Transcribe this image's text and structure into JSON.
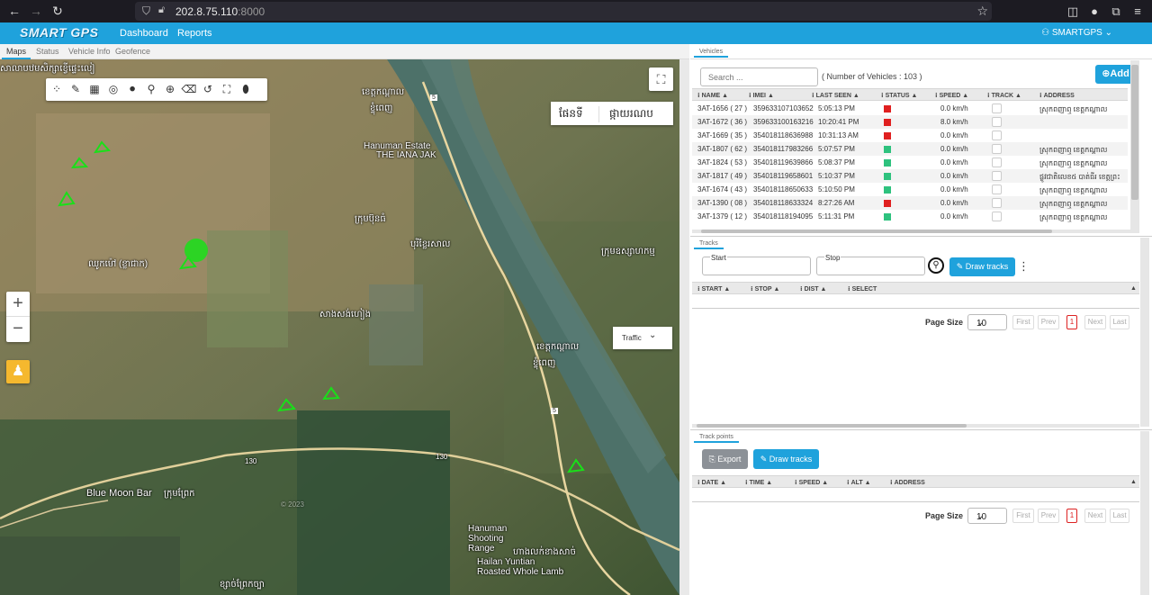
{
  "browser": {
    "url_host": "202.8.75.110",
    "url_port": ":8000"
  },
  "app": {
    "logo": "SMART GPS",
    "menu": [
      "Dashboard",
      "Reports"
    ],
    "user": "SMARTGPS"
  },
  "left_tabs": [
    "Maps",
    "Status",
    "Vehicle Info",
    "Geofence"
  ],
  "map": {
    "type_labels": [
      "ផែនទី",
      "ផ្កាយរណប"
    ],
    "traffic_label": "Traffic",
    "zoom_in": "+",
    "zoom_out": "−",
    "labels": [
      "សាលាបឋមសិក្សាខ្វើផ្ទេះលៀ",
      "ខេត្តកណ្ដាល",
      "ខ្ទុំពេញ",
      "Hanuman Estate",
      "THE IANA JAK",
      "ក្រុមប៊ុនធំ",
      "បុរីខ្លែរសាល",
      "ឈូកម៉ៅ (ខ្លាជាក)",
      "ក្រុមឧស្សាហកម្ម",
      "សាងសង់ហៀង",
      "ខេត្តកណ្ដាល",
      "ខ្ទុំពេញ",
      "Blue Moon Bar",
      "ក្រុមព្រែក",
      "Hanuman Shooting Range",
      "Hailan Yuntian Roasted Whole Lamb",
      "ហាងលក់ខាងសាច់",
      "ខ្សាច់ព្រែកច្បា"
    ],
    "road_labels": [
      "5",
      "130",
      "130",
      "5"
    ],
    "watermark": "© 2023"
  },
  "vehicles": {
    "tab": "Vehicles",
    "search_placeholder": "Search ...",
    "count_text": "( Number of Vehicles : 103 )",
    "add_label": "Add",
    "columns": [
      "NAME",
      "IMEI",
      "LAST SEEN",
      "STATUS",
      "SPEED",
      "TRACK",
      "ADDRESS"
    ],
    "rows": [
      {
        "name": "3AT-1656 ( 27 )",
        "imei": "359633107103652",
        "last_seen": "5:05:13 PM",
        "status": "red",
        "speed": "0.0 km/h",
        "address": "ស្រុកពញាឮ ខេត្តកណ្ដាល"
      },
      {
        "name": "3AT-1672 ( 36 )",
        "imei": "359633100163216",
        "last_seen": "10:20:41 PM",
        "status": "red",
        "speed": "8.0 km/h",
        "address": ""
      },
      {
        "name": "3AT-1669 ( 35 )",
        "imei": "354018118636988",
        "last_seen": "10:31:13 AM",
        "status": "red",
        "speed": "0.0 km/h",
        "address": ""
      },
      {
        "name": "3AT-1807 ( 62 )",
        "imei": "354018117983266",
        "last_seen": "5:07:57 PM",
        "status": "green",
        "speed": "0.0 km/h",
        "address": "ស្រុកពញាឮ ខេត្តកណ្ដាល"
      },
      {
        "name": "3AT-1824 ( 53 )",
        "imei": "354018119639866",
        "last_seen": "5:08:37 PM",
        "status": "green",
        "speed": "0.0 km/h",
        "address": "ស្រុកពញាឮ ខេត្តកណ្ដាល"
      },
      {
        "name": "3AT-1817 ( 49 )",
        "imei": "354018119658601",
        "last_seen": "5:10:37 PM",
        "status": "green",
        "speed": "0.0 km/h",
        "address": "ផ្លូវជាតិលេខ៥ បាត់ធីរ ខេត្តព្រះ"
      },
      {
        "name": "3AT-1674 ( 43 )",
        "imei": "354018118650633",
        "last_seen": "5:10:50 PM",
        "status": "green",
        "speed": "0.0 km/h",
        "address": "ស្រុកពញាឮ ខេត្តកណ្ដាល"
      },
      {
        "name": "3AT-1390 ( 08 )",
        "imei": "354018118633324",
        "last_seen": "8:27:26 AM",
        "status": "red",
        "speed": "0.0 km/h",
        "address": "ស្រុកពញាឮ ខេត្តកណ្ដាល"
      },
      {
        "name": "3AT-1379 ( 12 )",
        "imei": "354018118194095",
        "last_seen": "5:11:31 PM",
        "status": "green",
        "speed": "0.0 km/h",
        "address": "ស្រុកពញាឮ ខេត្តកណ្ដាល"
      }
    ]
  },
  "tracks": {
    "tab": "Tracks",
    "start_label": "Start",
    "stop_label": "Stop",
    "draw_label": "Draw tracks",
    "columns": [
      "START",
      "STOP",
      "DIST",
      "SELECT"
    ],
    "page_size_label": "Page Size",
    "page_size": "10",
    "pager": [
      "First",
      "Prev",
      "1",
      "Next",
      "Last"
    ]
  },
  "track_points": {
    "tab": "Track points",
    "export_label": "Export",
    "draw_label": "Draw tracks",
    "columns": [
      "DATE",
      "TIME",
      "SPEED",
      "ALT",
      "ADDRESS"
    ],
    "page_size_label": "Page Size",
    "page_size": "10",
    "pager": [
      "First",
      "Prev",
      "1",
      "Next",
      "Last"
    ]
  },
  "colors": {
    "accent": "#1fa2dc",
    "status_red": "#e02020",
    "status_green": "#2ec27e",
    "browser_bg": "#1c1b22"
  }
}
